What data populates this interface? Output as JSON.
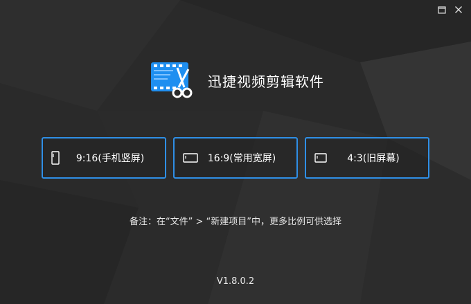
{
  "window": {
    "controls": {
      "maximize_icon": "maximize-icon",
      "close_icon": "close-icon"
    }
  },
  "brand": {
    "title": "迅捷视频剪辑软件",
    "logo_icon": "video-scissors-logo-icon"
  },
  "ratios": [
    {
      "label": "9:16(手机竖屏)",
      "icon": "portrait-phone-icon"
    },
    {
      "label": "16:9(常用宽屏)",
      "icon": "widescreen-icon"
    },
    {
      "label": "4:3(旧屏幕)",
      "icon": "standard-screen-icon"
    }
  ],
  "note": "备注：在“文件” > “新建项目”中，更多比例可供选择",
  "version": "V1.8.0.2",
  "colors": {
    "background": "#2a2a2a",
    "accent": "#2f8fe6",
    "logo_blue": "#1f8ff0",
    "text": "#ffffff"
  }
}
